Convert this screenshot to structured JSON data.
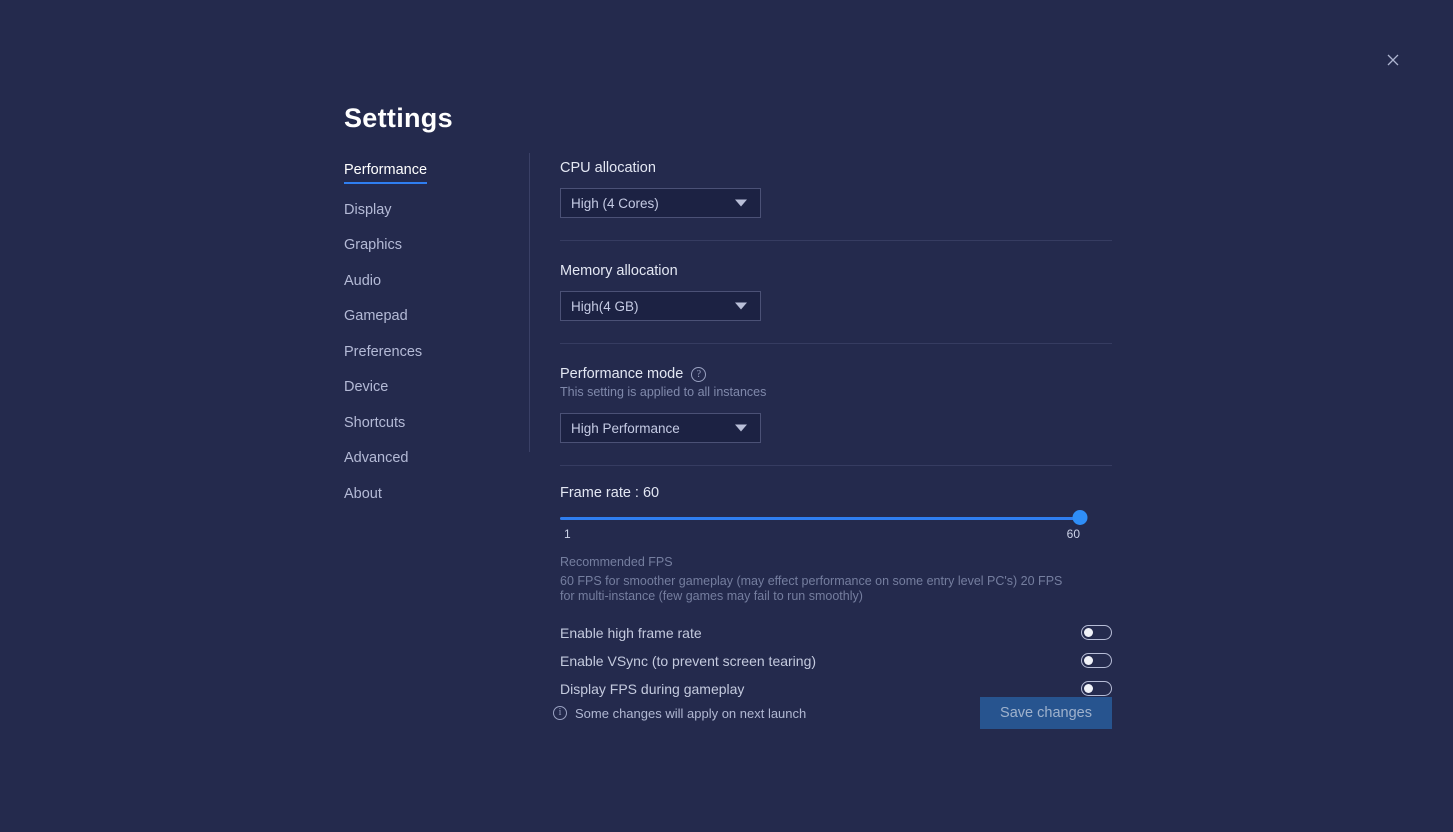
{
  "window": {
    "title": "Settings",
    "close_icon": "close-icon",
    "accent_color": "#2f7ef0",
    "background_color": "#242a4d",
    "panel_color": "#1c2243"
  },
  "sidebar": {
    "items": [
      {
        "label": "Performance",
        "active": true
      },
      {
        "label": "Display",
        "active": false
      },
      {
        "label": "Graphics",
        "active": false
      },
      {
        "label": "Audio",
        "active": false
      },
      {
        "label": "Gamepad",
        "active": false
      },
      {
        "label": "Preferences",
        "active": false
      },
      {
        "label": "Device",
        "active": false
      },
      {
        "label": "Shortcuts",
        "active": false
      },
      {
        "label": "Advanced",
        "active": false
      },
      {
        "label": "About",
        "active": false
      }
    ]
  },
  "content": {
    "cpu": {
      "label": "CPU allocation",
      "value": "High (4 Cores)",
      "caret_icon": "chevron-down-icon"
    },
    "memory": {
      "label": "Memory allocation",
      "value": "High(4 GB)",
      "caret_icon": "chevron-down-icon"
    },
    "performance_mode": {
      "label": "Performance mode",
      "help_icon": "help-circle-icon",
      "help_glyph": "?",
      "subtitle": "This setting is applied to all instances",
      "value": "High Performance",
      "caret_icon": "chevron-down-icon"
    },
    "frame_rate": {
      "label": "Frame rate : 60",
      "value": 60,
      "min_label": "1",
      "max_label": "60",
      "min": 1,
      "max": 60,
      "percent": 100,
      "recommended_title": "Recommended FPS",
      "recommended_text": "60 FPS for smoother gameplay (may effect performance on some entry level PC's) 20 FPS for multi-instance (few games may fail to run smoothly)"
    },
    "toggles": [
      {
        "label": "Enable high frame rate",
        "on": false
      },
      {
        "label": "Enable VSync (to prevent screen tearing)",
        "on": false
      },
      {
        "label": "Display FPS during gameplay",
        "on": false
      }
    ]
  },
  "footer": {
    "info_icon": "info-circle-icon",
    "info_glyph": "i",
    "note": "Some changes will apply on next launch",
    "save_label": "Save changes"
  }
}
